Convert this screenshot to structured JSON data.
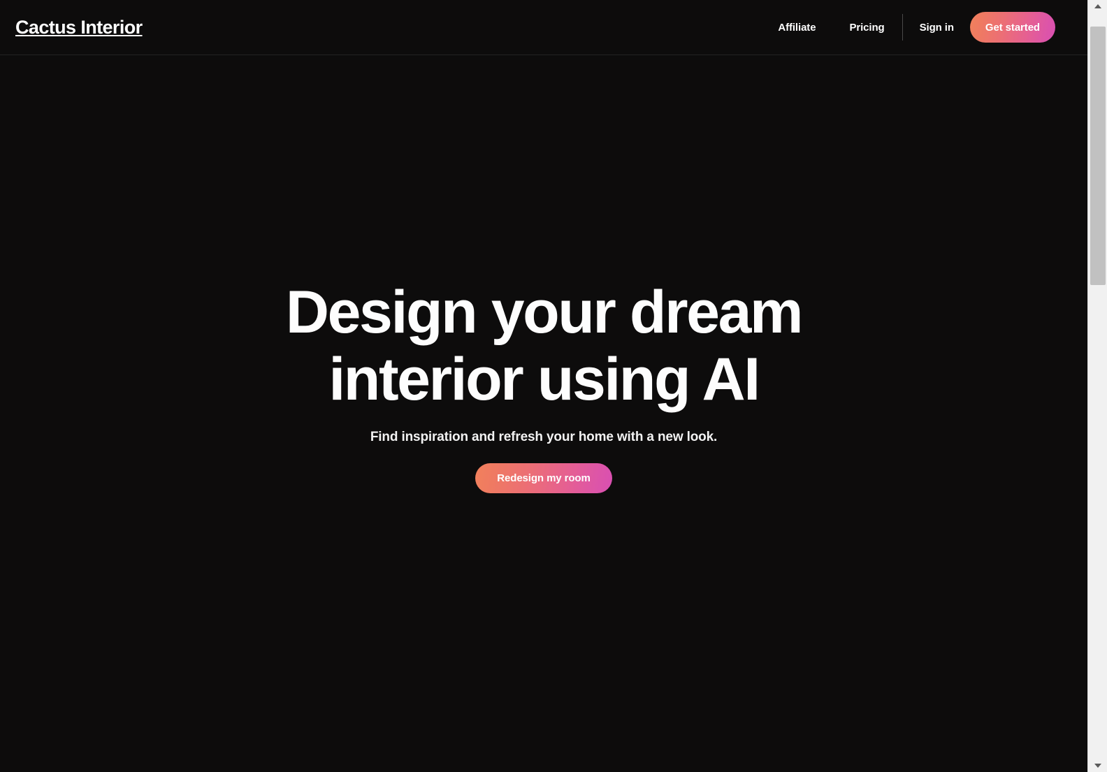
{
  "brand": {
    "name": "Cactus Interior"
  },
  "header": {
    "nav_links": [
      {
        "label": "Affiliate"
      },
      {
        "label": "Pricing"
      },
      {
        "label": "Sign in"
      }
    ],
    "cta_label": "Get started"
  },
  "hero": {
    "title": "Design your dream interior using AI",
    "subtitle": "Find inspiration and refresh your home with a new look.",
    "cta_label": "Redesign my room"
  },
  "colors": {
    "background": "#0d0c0c",
    "text_primary": "#fdfdfd",
    "gradient_start": "#f2815c",
    "gradient_end": "#d94fb2",
    "divider": "#4a4a4a",
    "header_border": "#232323"
  },
  "icons": {
    "scroll_up": "triangle-up-icon",
    "scroll_down": "triangle-down-icon"
  }
}
